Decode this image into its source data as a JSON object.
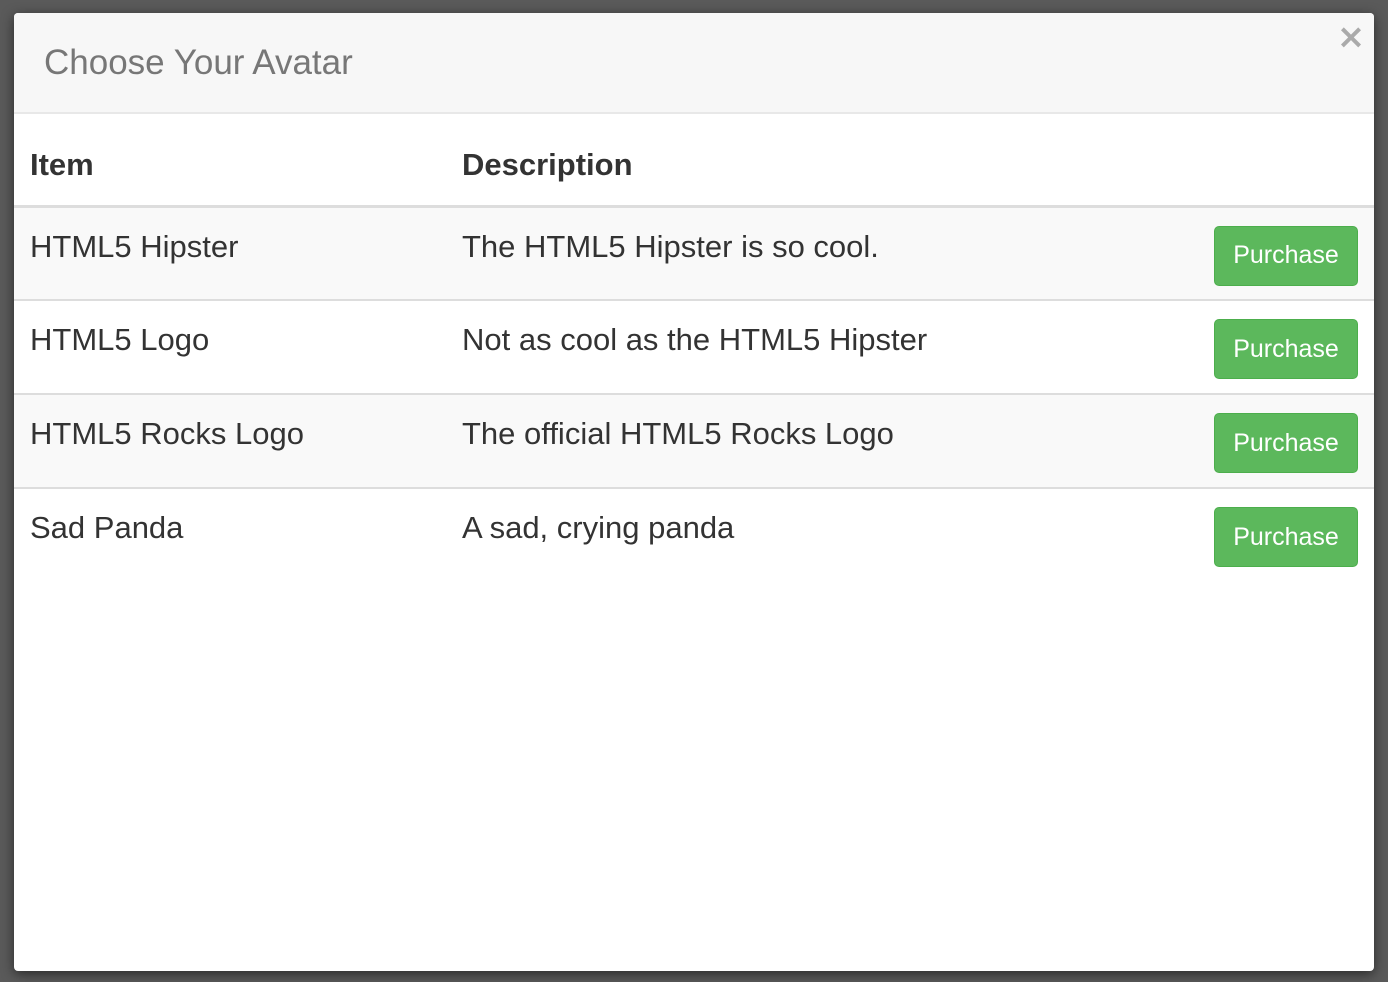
{
  "modal": {
    "title": "Choose Your Avatar",
    "close_glyph": "×",
    "close_icon": "close-icon"
  },
  "table": {
    "headers": [
      "Item",
      "Description",
      ""
    ],
    "rows": [
      {
        "item": "HTML5 Hipster",
        "description": "The HTML5 Hipster is so cool.",
        "action": "Purchase"
      },
      {
        "item": "HTML5 Logo",
        "description": "Not as cool as the HTML5 Hipster",
        "action": "Purchase"
      },
      {
        "item": "HTML5 Rocks Logo",
        "description": "The official HTML5 Rocks Logo",
        "action": "Purchase"
      },
      {
        "item": "Sad Panda",
        "description": "A sad, crying panda",
        "action": "Purchase"
      }
    ]
  },
  "colors": {
    "backdrop": "#5a5a5a",
    "header_bg": "#f7f7f7",
    "stripe": "#f9f9f9",
    "button": "#5cb85c",
    "text": "#333333",
    "title": "#777777"
  }
}
